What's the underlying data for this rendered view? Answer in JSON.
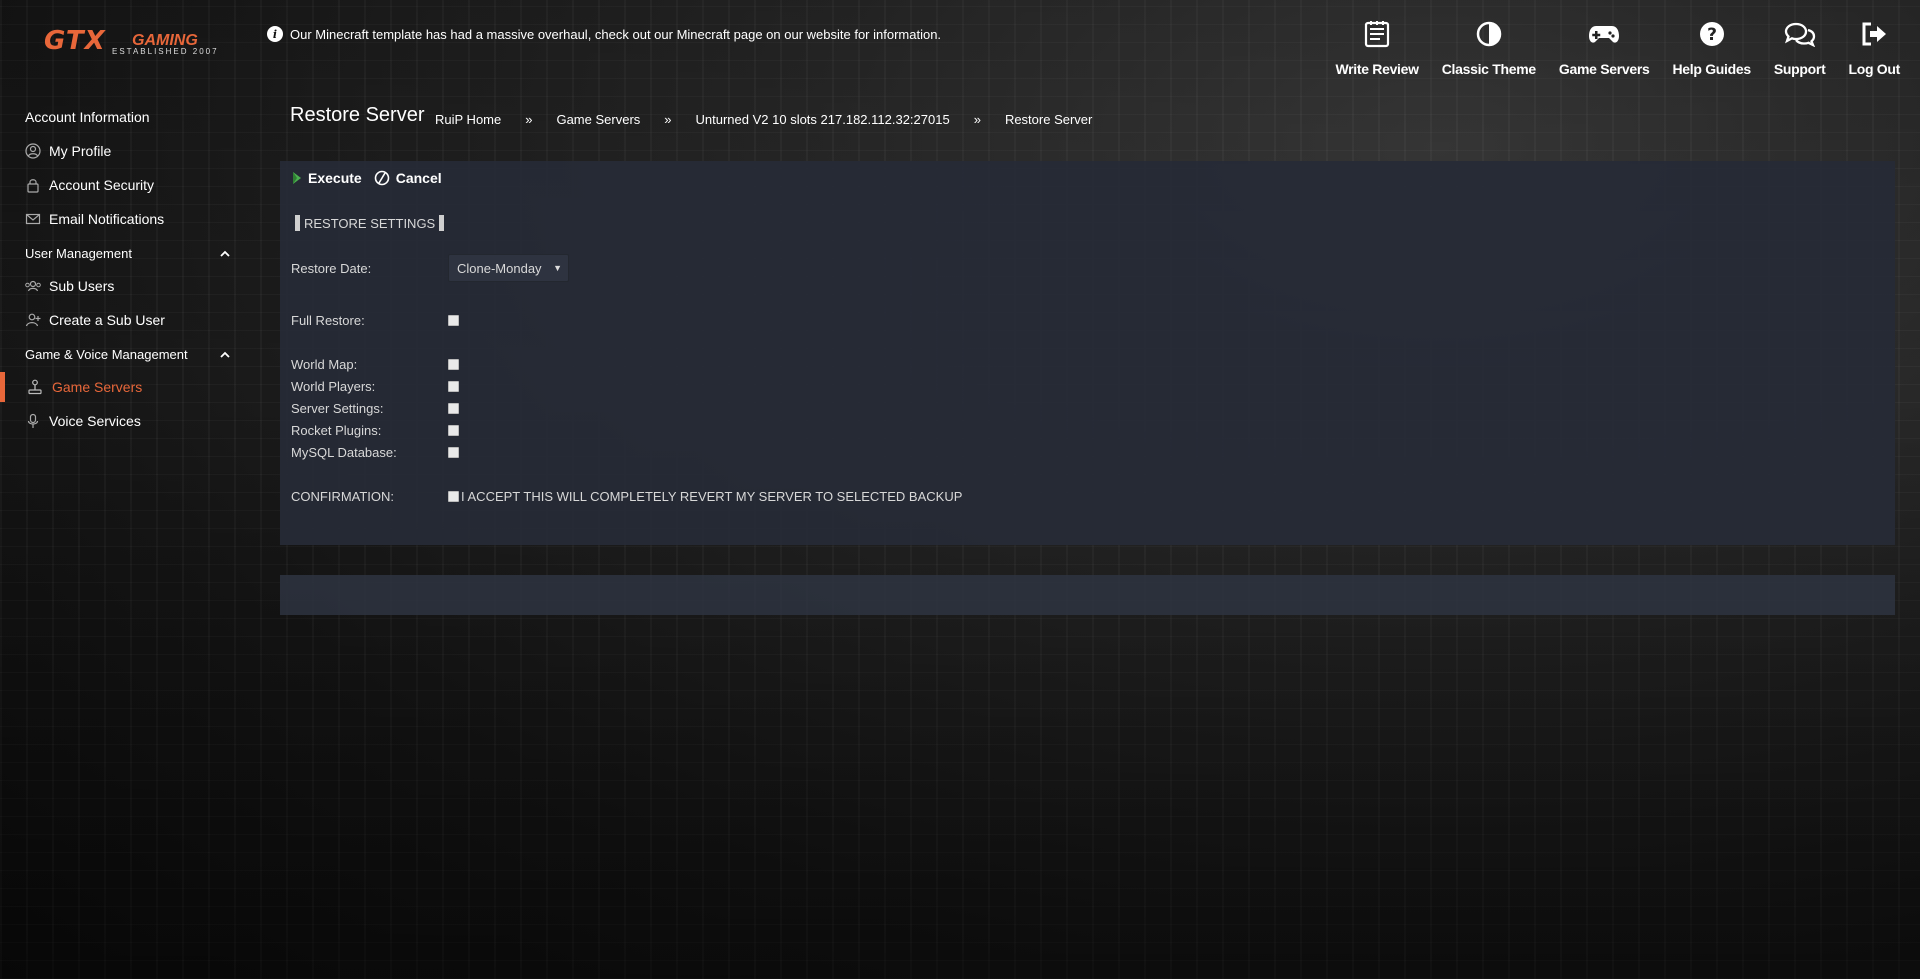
{
  "brand": {
    "logo_text": "GTX",
    "logo_sub": "GAMING",
    "logo_tagline": "ESTABLISHED 2007"
  },
  "notice": {
    "text": "Our Minecraft template has had a massive overhaul, check out our Minecraft page on our website for information."
  },
  "topnav": [
    {
      "label": "Write Review",
      "icon": "write-review-icon"
    },
    {
      "label": "Classic Theme",
      "icon": "contrast-icon"
    },
    {
      "label": "Game Servers",
      "icon": "gamepad-icon"
    },
    {
      "label": "Help Guides",
      "icon": "question-icon"
    },
    {
      "label": "Support",
      "icon": "chat-bubbles-icon"
    },
    {
      "label": "Log Out",
      "icon": "logout-icon"
    }
  ],
  "sidebar": {
    "account_heading": "Account Information",
    "account_items": [
      {
        "label": "My Profile",
        "icon": "user-icon"
      },
      {
        "label": "Account Security",
        "icon": "lock-icon"
      },
      {
        "label": "Email Notifications",
        "icon": "envelope-icon"
      }
    ],
    "user_mgmt_heading": "User Management",
    "user_items": [
      {
        "label": "Sub Users",
        "icon": "users-icon"
      },
      {
        "label": "Create a Sub User",
        "icon": "add-user-icon"
      }
    ],
    "game_mgmt_heading": "Game & Voice Management",
    "game_items": [
      {
        "label": "Game Servers",
        "icon": "joystick-icon",
        "active": true
      },
      {
        "label": "Voice Services",
        "icon": "microphone-icon"
      }
    ]
  },
  "page": {
    "title": "Restore Server",
    "breadcrumbs": [
      "RuiP Home",
      "»",
      "Game Servers",
      "»",
      "Unturned V2 10 slots 217.182.112.32:27015",
      "»",
      "Restore Server"
    ]
  },
  "actions": {
    "execute": "Execute",
    "cancel": "Cancel"
  },
  "form": {
    "section_title": "RESTORE SETTINGS",
    "restore_date_label": "Restore Date:",
    "restore_date_value": "Clone-Monday",
    "full_restore_label": "Full Restore:",
    "options": [
      "World Map:",
      "World Players:",
      "Server Settings:",
      "Rocket Plugins:",
      "MySQL Database:"
    ],
    "confirmation_label": "CONFIRMATION:",
    "confirmation_text": "I ACCEPT THIS WILL COMPLETELY REVERT MY SERVER TO SELECTED BACKUP"
  },
  "colors": {
    "accent": "#e8673a",
    "panel": "#262b36"
  }
}
